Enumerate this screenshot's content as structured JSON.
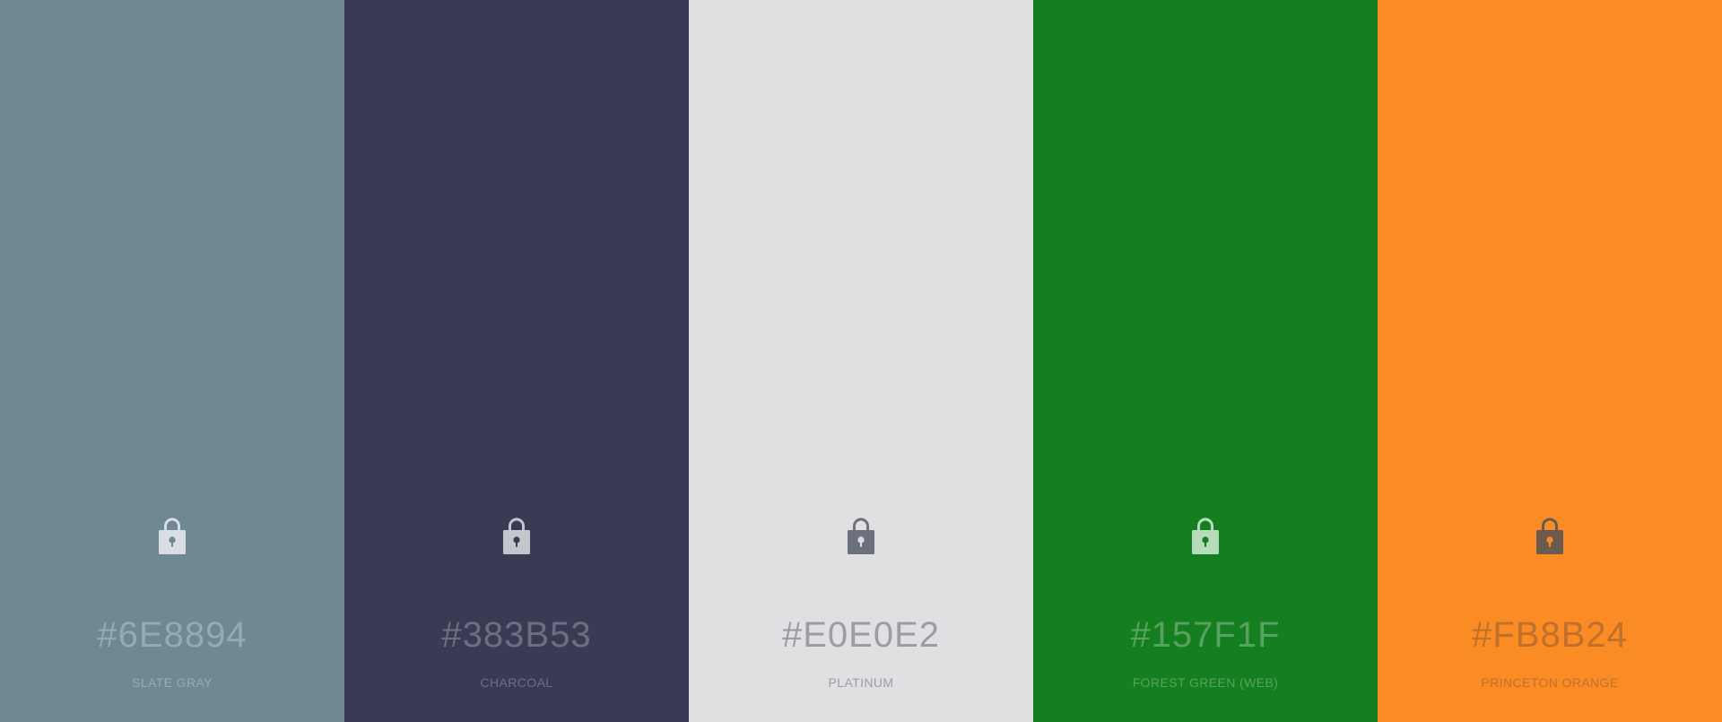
{
  "palette": {
    "swatches": [
      {
        "hex": "#6E8894",
        "name": "SLATE GRAY",
        "bg": "#6E8894",
        "text_color": "#96AAB3",
        "lock_color": "#D8DEE1",
        "hole_color": "#6E8894",
        "icon": "lock-icon"
      },
      {
        "hex": "#383B53",
        "name": "CHARCOAL",
        "bg": "#383B53",
        "text_color": "#6C6E82",
        "lock_color": "#C4C5CD",
        "hole_color": "#383B53",
        "icon": "lock-icon"
      },
      {
        "hex": "#E0E0E2",
        "name": "PLATINUM",
        "bg": "#E0E0E2",
        "text_color": "#9C9DA3",
        "lock_color": "#6D717D",
        "hole_color": "#E0E0E2",
        "icon": "lock-icon"
      },
      {
        "hex": "#157F1F",
        "name": "FOREST GREEN (WEB)",
        "bg": "#157F1F",
        "text_color": "#58A160",
        "lock_color": "#B7DCBB",
        "hole_color": "#157F1F",
        "icon": "lock-icon"
      },
      {
        "hex": "#FB8B24",
        "name": "PRINCETON ORANGE",
        "bg": "#FB8B24",
        "text_color": "#C0702A",
        "lock_color": "#6B5B4E",
        "hole_color": "#FB8B24",
        "icon": "lock-icon"
      }
    ]
  }
}
